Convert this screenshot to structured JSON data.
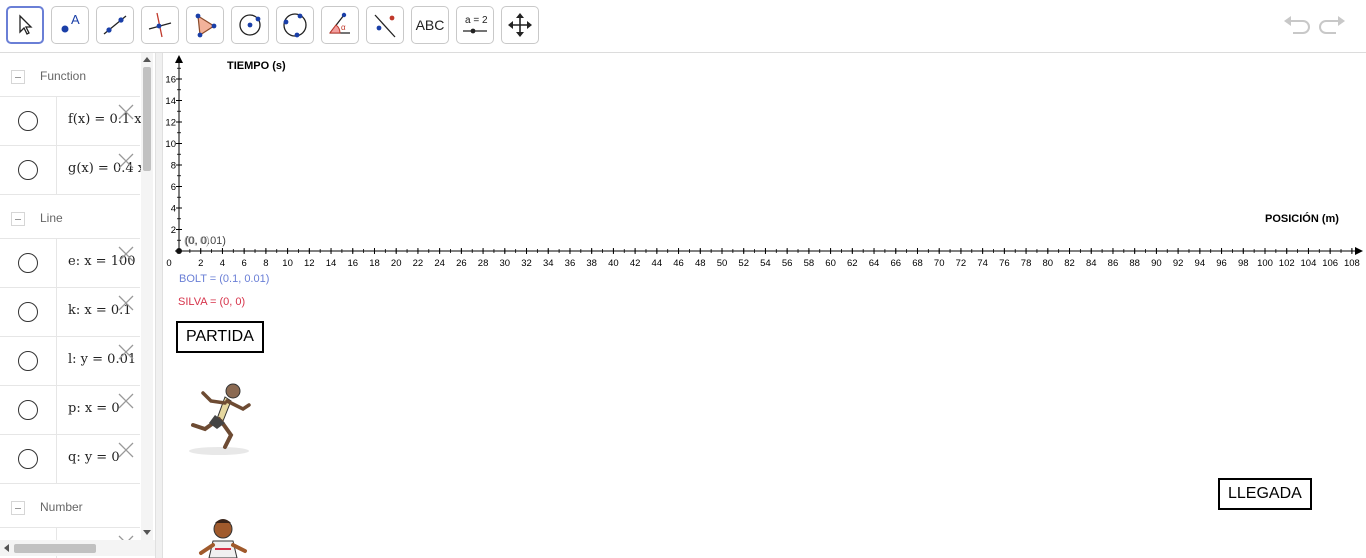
{
  "toolbar": {
    "tools": [
      {
        "name": "move-tool",
        "icon": "arrow-pointer-icon"
      },
      {
        "name": "point-tool",
        "icon": "point-icon"
      },
      {
        "name": "line-tool",
        "icon": "line-icon"
      },
      {
        "name": "perpendicular-line-tool",
        "icon": "perpendicular-icon"
      },
      {
        "name": "polygon-tool",
        "icon": "polygon-icon"
      },
      {
        "name": "circle-center-tool",
        "icon": "circle-center-icon"
      },
      {
        "name": "circle-three-points-tool",
        "icon": "circle-three-points-icon"
      },
      {
        "name": "angle-tool",
        "icon": "angle-icon"
      },
      {
        "name": "reflect-tool",
        "icon": "reflect-icon"
      },
      {
        "name": "text-tool",
        "label": "ABC"
      },
      {
        "name": "slider-tool",
        "label": "a = 2"
      },
      {
        "name": "move-graphics-tool",
        "icon": "move-arrows-icon"
      }
    ],
    "undo_icon": "undo-icon",
    "redo_icon": "redo-icon"
  },
  "algebra": {
    "groups": [
      {
        "name": "Function",
        "items": [
          "f(x) = 0.1 x",
          "g(x) = 0.4 x"
        ]
      },
      {
        "name": "Line",
        "items": [
          "e: x = 100",
          "k: x = 0.1",
          "l: y = 0.01",
          "p: x = 0",
          "q: y = 0"
        ]
      },
      {
        "name": "Number",
        "items": [
          ""
        ]
      }
    ]
  },
  "graphics": {
    "x_axis_label": "POSICIÓN (m)",
    "y_axis_label": "TIEMPO (s)",
    "origin_label": "(0, 0.01)",
    "origin_label_overlap": "(0, 0)",
    "bolt_label": "BOLT = (0.1, 0.01)",
    "silva_label": "SILVA = (0, 0)",
    "start_text": "PARTIDA",
    "finish_text": "LLEGADA",
    "colors": {
      "bolt": "#6a7fd6",
      "silva": "#d6334a",
      "axis": "#000000"
    },
    "x_ticks": [
      0,
      2,
      4,
      6,
      8,
      10,
      12,
      14,
      16,
      18,
      20,
      22,
      24,
      26,
      28,
      30,
      32,
      34,
      36,
      38,
      40,
      42,
      44,
      46,
      48,
      50,
      52,
      54,
      56,
      58,
      60,
      62,
      64,
      66,
      68,
      70,
      72,
      74,
      76,
      78,
      80,
      82,
      84,
      86,
      88,
      90,
      92,
      94,
      96,
      98,
      100,
      102,
      104,
      106,
      108
    ],
    "y_ticks": [
      2,
      4,
      6,
      8,
      10,
      12,
      14,
      16
    ]
  }
}
